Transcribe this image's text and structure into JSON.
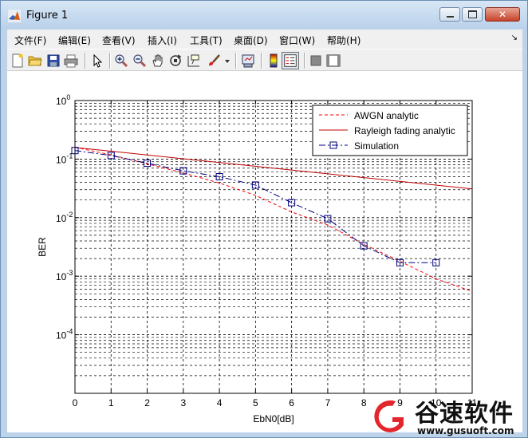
{
  "window": {
    "title": "Figure 1",
    "buttons": {
      "minimize": "minimize",
      "maximize": "maximize",
      "close": "close"
    }
  },
  "menu": [
    "文件(F)",
    "编辑(E)",
    "查看(V)",
    "插入(I)",
    "工具(T)",
    "桌面(D)",
    "窗口(W)",
    "帮助(H)"
  ],
  "menu_arrow": "↘",
  "toolbar": [
    "new-figure-icon",
    "open-file-icon",
    "save-icon",
    "print-icon",
    "edit-plot-arrow-icon",
    "zoom-in-icon",
    "zoom-out-icon",
    "pan-hand-icon",
    "rotate-3d-icon",
    "data-cursor-icon",
    "brush-icon",
    "insert-colorbar-icon",
    "insert-legend-icon",
    "hide-plot-tools-icon",
    "show-plot-tools-icon"
  ],
  "chart_data": {
    "type": "line",
    "title": "",
    "xlabel": "EbN0[dB]",
    "ylabel": "BER",
    "xlim": [
      0,
      11
    ],
    "ylim": [
      1e-05,
      1
    ],
    "yscale": "log",
    "grid": true,
    "x_ticks": [
      "0",
      "1",
      "2",
      "3",
      "4",
      "5",
      "6",
      "7",
      "8",
      "9",
      "10",
      "11"
    ],
    "y_ticks": [
      {
        "base": "10",
        "exp": "0"
      },
      {
        "base": "10",
        "exp": "-1"
      },
      {
        "base": "10",
        "exp": "-2"
      },
      {
        "base": "10",
        "exp": "-3"
      },
      {
        "base": "10",
        "exp": "-4"
      }
    ],
    "legend_position": "top-right",
    "series": [
      {
        "name": "AWGN analytic",
        "color": "#ff0000",
        "style": "dashed",
        "x": [
          0,
          1,
          2,
          3,
          4,
          5,
          6,
          7,
          8,
          9,
          10,
          11
        ],
        "y": [
          0.159,
          0.118,
          0.083,
          0.058,
          0.039,
          0.024,
          0.0125,
          0.0075,
          0.0035,
          0.0018,
          0.0009,
          0.00055
        ]
      },
      {
        "name": "Rayleigh fading analytic",
        "color": "#c00000",
        "style": "solid",
        "x": [
          0,
          11
        ],
        "y": [
          0.158,
          0.031
        ]
      },
      {
        "name": "Simulation",
        "color": "#000080",
        "style": "dashdot",
        "marker": "square",
        "x": [
          0,
          1,
          2,
          3,
          4,
          5,
          6,
          7,
          8,
          9,
          10
        ],
        "y": [
          0.14,
          0.115,
          0.085,
          0.063,
          0.05,
          0.036,
          0.018,
          0.0096,
          0.0033,
          0.0017,
          0.0017
        ]
      }
    ]
  },
  "watermark": {
    "name": "谷速软件",
    "url": "www.gusuoft.com"
  }
}
